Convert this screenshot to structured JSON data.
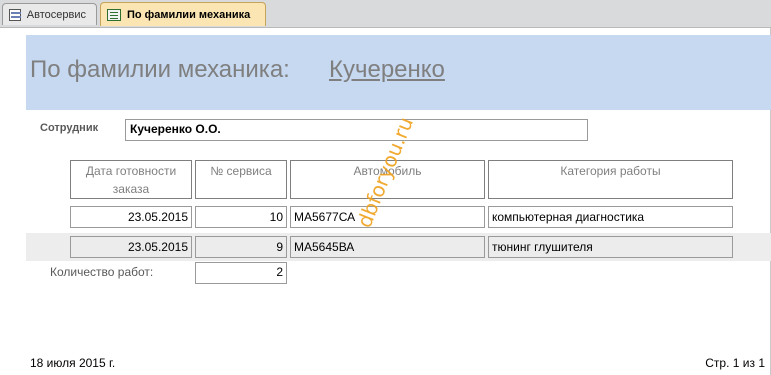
{
  "tabs": [
    {
      "label": "Автосервис",
      "icon": "form-icon",
      "active": false
    },
    {
      "label": "По фамилии механика",
      "icon": "report-icon",
      "active": true
    }
  ],
  "report": {
    "title": "По фамилии механика:",
    "mechanic_name": "Кучеренко",
    "employee_label": "Сотрудник",
    "employee_value": "Кучеренко О.О.",
    "columns": [
      "Дата готовности заказа",
      "№ сервиса",
      "Автомобиль",
      "Категория работы"
    ],
    "rows": [
      {
        "date": "23.05.2015",
        "service_no": "10",
        "car": "МА5677СА",
        "category": "компьютерная диагностика"
      },
      {
        "date": "23.05.2015",
        "service_no": "9",
        "car": "МА5645ВА",
        "category": "тюнинг глушителя"
      }
    ],
    "count_label": "Количество работ:",
    "count_value": "2"
  },
  "footer": {
    "date": "18 июля 2015 г.",
    "page": "Стр. 1 из 1"
  },
  "watermark": "dbforyou.ru",
  "colors": {
    "header_band": "#c6d9f1",
    "active_tab": "#fbe6b3",
    "watermark": "#f0a11b",
    "alt_row": "#ededed"
  }
}
